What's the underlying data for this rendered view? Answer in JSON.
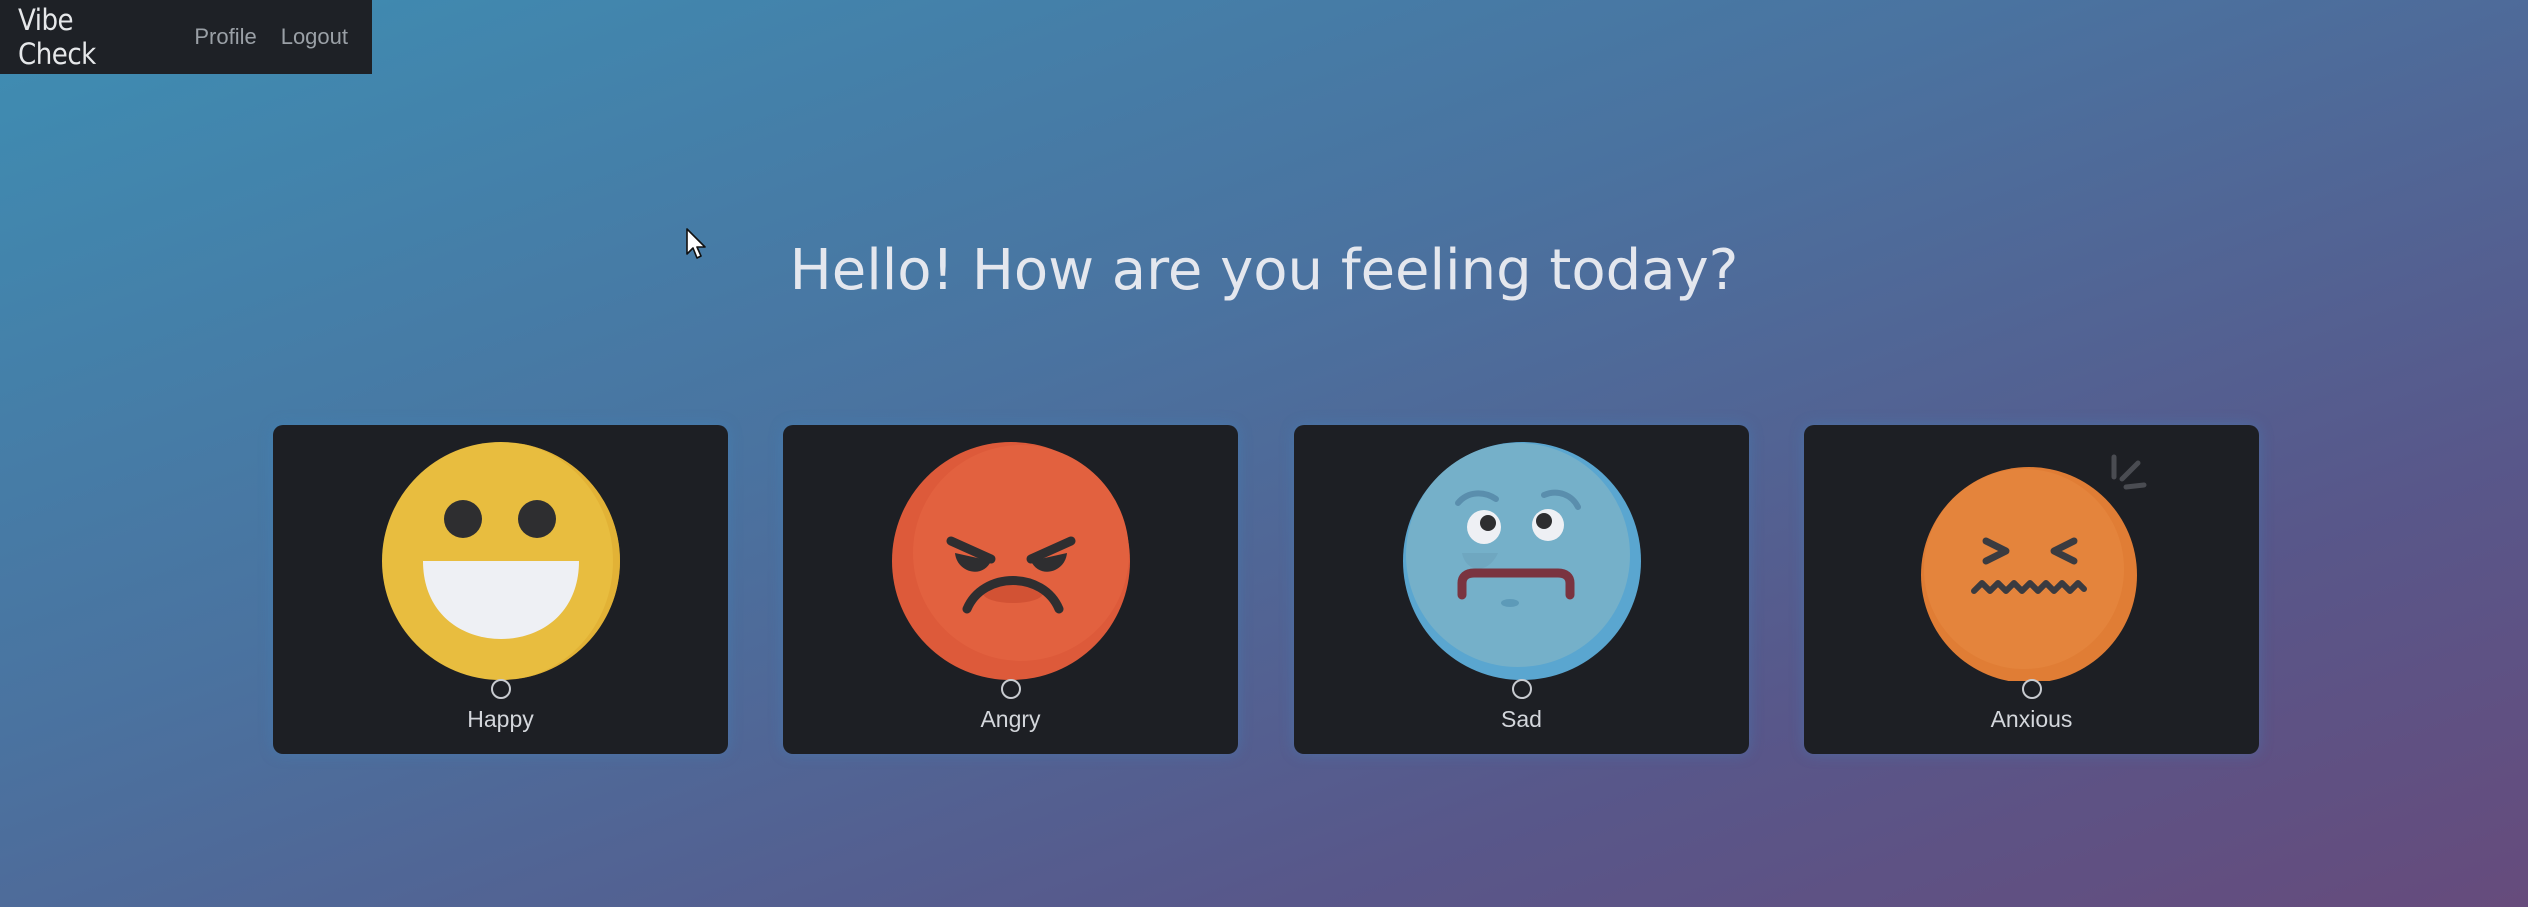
{
  "nav": {
    "brand": "Vibe Check",
    "links": [
      "Profile",
      "Logout"
    ]
  },
  "heading": "Hello! How are you feeling today?",
  "moods": [
    {
      "label": "Happy",
      "icon": "happy-face-icon",
      "color": "#e8bd3f"
    },
    {
      "label": "Angry",
      "icon": "angry-face-icon",
      "color": "#dd5a3a"
    },
    {
      "label": "Sad",
      "icon": "sad-face-icon",
      "color": "#75b0c9"
    },
    {
      "label": "Anxious",
      "icon": "anxious-face-icon",
      "color": "#e07d35"
    }
  ],
  "colors": {
    "card": "#1d1f24",
    "navbar": "#1e2126"
  }
}
